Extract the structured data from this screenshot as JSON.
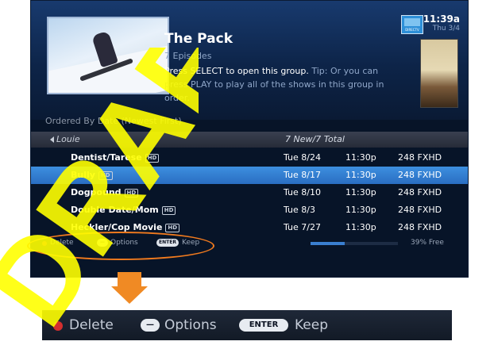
{
  "header": {
    "title": "The Pack",
    "episodes": "7 Episodes",
    "description": "Press SELECT to open this group.",
    "tip": "Tip: Or you can press PLAY to play all of the shows in this group in order.",
    "time": "11:39a",
    "date": "Thu 3/4",
    "logo": "DIRECTV"
  },
  "list": {
    "ordered_label": "Ordered By Date (Newest First)",
    "group": {
      "name": "Louie",
      "count": "7 New/7 Total"
    },
    "hd_badge": "HD",
    "rows": [
      {
        "title": "Dentist/Tarese",
        "date": "Tue 8/24",
        "time": "11:30p",
        "channel": "248 FXHD",
        "selected": false
      },
      {
        "title": "Bully",
        "date": "Tue 8/17",
        "time": "11:30p",
        "channel": "248 FXHD",
        "selected": true
      },
      {
        "title": "Dogpound",
        "date": "Tue 8/10",
        "time": "11:30p",
        "channel": "248 FXHD",
        "selected": false
      },
      {
        "title": "Double Date/Mom",
        "date": "Tue 8/3",
        "time": "11:30p",
        "channel": "248 FXHD",
        "selected": false
      },
      {
        "title": "Heckler/Cop Movie",
        "date": "Tue 7/27",
        "time": "11:30p",
        "channel": "248 FXHD",
        "selected": false
      }
    ]
  },
  "footer": {
    "delete_label": "Delete",
    "options_label": "Options",
    "enter_key": "ENTER",
    "keep_label": "Keep",
    "disk_free_text": "39% Free",
    "disk_free_fraction": 0.39
  },
  "watermark": "DRAFT",
  "colors": {
    "delete_dot": "#d32f2f",
    "selection": "#2f7fd4",
    "annotation": "#f07a1e",
    "watermark": "#ffff00"
  }
}
